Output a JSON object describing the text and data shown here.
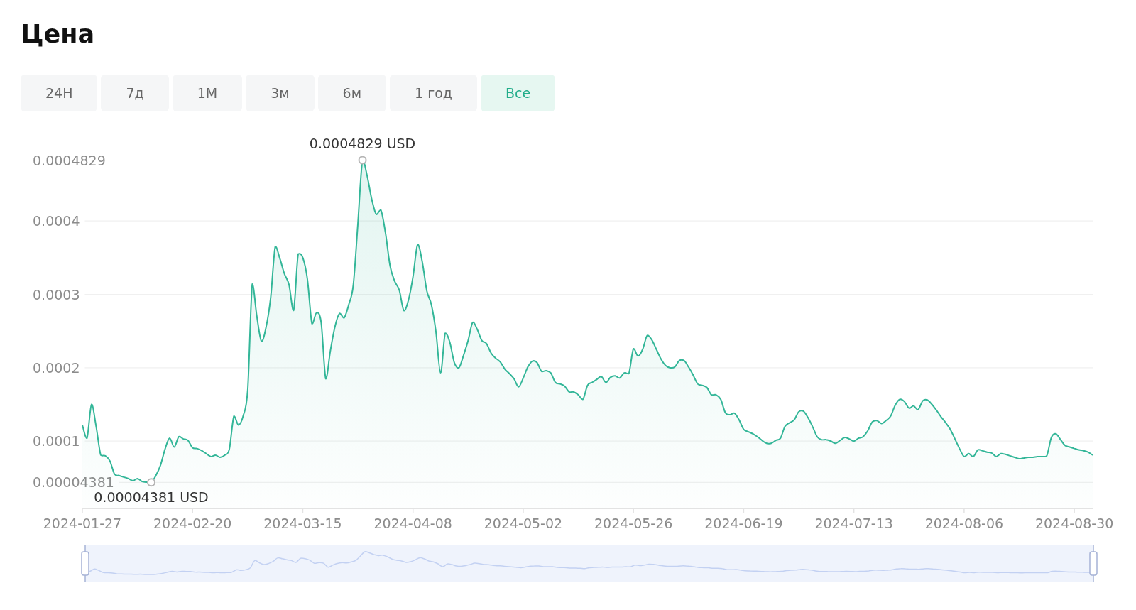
{
  "title": "Цена",
  "period_tabs": [
    {
      "label": "24H",
      "selected": false
    },
    {
      "label": "7д",
      "selected": false
    },
    {
      "label": "1M",
      "selected": false
    },
    {
      "label": "3м",
      "selected": false
    },
    {
      "label": "6м",
      "selected": false
    },
    {
      "label": "1 год",
      "selected": false
    },
    {
      "label": "Все",
      "selected": true
    }
  ],
  "price_chart": {
    "chart_data": {
      "type": "area",
      "grid": true,
      "categories": [
        "2024-01-27",
        null,
        null,
        null,
        null,
        null,
        null,
        null,
        null,
        null,
        null,
        null,
        null,
        null,
        null,
        null,
        null,
        null,
        null,
        null,
        null,
        null,
        null,
        null,
        "2024-02-20",
        null,
        null,
        null,
        null,
        null,
        null,
        null,
        null,
        null,
        null,
        null,
        null,
        null,
        null,
        null,
        null,
        null,
        null,
        null,
        null,
        null,
        null,
        null,
        "2024-03-15",
        null,
        null,
        null,
        null,
        null,
        null,
        null,
        null,
        null,
        null,
        null,
        null,
        null,
        null,
        null,
        null,
        null,
        null,
        null,
        null,
        null,
        null,
        null,
        "2024-04-08",
        null,
        null,
        null,
        null,
        null,
        null,
        null,
        null,
        null,
        null,
        null,
        null,
        null,
        null,
        null,
        null,
        null,
        null,
        null,
        null,
        null,
        null,
        null,
        "2024-05-02",
        null,
        null,
        null,
        null,
        null,
        null,
        null,
        null,
        null,
        null,
        null,
        null,
        null,
        null,
        null,
        null,
        null,
        null,
        null,
        null,
        null,
        null,
        null,
        "2024-05-26",
        null,
        null,
        null,
        null,
        null,
        null,
        null,
        null,
        null,
        null,
        null,
        null,
        null,
        null,
        null,
        null,
        null,
        null,
        null,
        null,
        null,
        null,
        null,
        "2024-06-19",
        null,
        null,
        null,
        null,
        null,
        null,
        null,
        null,
        null,
        null,
        null,
        null,
        null,
        null,
        null,
        null,
        null,
        null,
        null,
        null,
        null,
        null,
        null,
        "2024-07-13",
        null,
        null,
        null,
        null,
        null,
        null,
        null,
        null,
        null,
        null,
        null,
        null,
        null,
        null,
        null,
        null,
        null,
        null,
        null,
        null,
        null,
        null,
        null,
        "2024-08-06",
        null,
        null,
        null,
        null,
        null,
        null,
        null,
        null,
        null,
        null,
        null,
        null,
        null,
        null,
        null,
        null,
        null,
        null,
        null,
        null,
        null,
        null,
        null,
        "2024-08-30",
        null,
        null,
        null,
        null
      ],
      "values": [
        0.000122,
        0.000104,
        0.00015,
        0.00012,
        8.1e-05,
        8e-05,
        7.3e-05,
        5.5e-05,
        5.3e-05,
        5.1e-05,
        4.9e-05,
        4.6e-05,
        4.9e-05,
        4.5e-05,
        4.4e-05,
        4.381e-05,
        5.3e-05,
        6.7e-05,
        8.9e-05,
        0.000104,
        9.2e-05,
        0.000106,
        0.000103,
        0.000101,
        9.1e-05,
        9e-05,
        8.7e-05,
        8.3e-05,
        7.9e-05,
        8.1e-05,
        7.8e-05,
        8.1e-05,
        8.9e-05,
        0.000134,
        0.000122,
        0.000134,
        0.00017,
        0.000314,
        0.00027,
        0.000236,
        0.000255,
        0.000295,
        0.000365,
        0.000349,
        0.000328,
        0.000313,
        0.000278,
        0.000355,
        0.00035,
        0.000321,
        0.00026,
        0.000275,
        0.000262,
        0.000185,
        0.000223,
        0.000256,
        0.000274,
        0.000268,
        0.000286,
        0.000313,
        0.000397,
        0.0004829,
        0.000462,
        0.00043,
        0.000409,
        0.000415,
        0.000384,
        0.000339,
        0.000318,
        0.000306,
        0.000278,
        0.000292,
        0.000324,
        0.000368,
        0.000345,
        0.000305,
        0.000286,
        0.000249,
        0.000193,
        0.000247,
        0.000235,
        0.000207,
        0.0002,
        0.000217,
        0.000237,
        0.000262,
        0.000252,
        0.000237,
        0.000233,
        0.00022,
        0.000213,
        0.000208,
        0.000198,
        0.000192,
        0.000185,
        0.000174,
        0.000186,
        0.000201,
        0.000209,
        0.000207,
        0.000195,
        0.000196,
        0.000193,
        0.00018,
        0.000178,
        0.000175,
        0.000167,
        0.000167,
        0.000163,
        0.000157,
        0.000176,
        0.00018,
        0.000184,
        0.000188,
        0.00018,
        0.000187,
        0.000189,
        0.000186,
        0.000193,
        0.000192,
        0.000226,
        0.000216,
        0.000225,
        0.000244,
        0.000238,
        0.000225,
        0.000212,
        0.000203,
        0.0002,
        0.000201,
        0.00021,
        0.00021,
        0.000201,
        0.00019,
        0.000178,
        0.000176,
        0.000173,
        0.000163,
        0.000163,
        0.000157,
        0.000139,
        0.000136,
        0.000138,
        0.000129,
        0.000116,
        0.000113,
        0.00011,
        0.000106,
        0.000101,
        9.7e-05,
        9.7e-05,
        0.000101,
        0.000104,
        0.00012,
        0.000125,
        0.000129,
        0.00014,
        0.000141,
        0.000132,
        0.00012,
        0.000106,
        0.000102,
        0.000102,
        0.0001,
        9.7e-05,
        0.000101,
        0.000105,
        0.000103,
        0.0001,
        0.000104,
        0.000106,
        0.000114,
        0.000126,
        0.000128,
        0.000124,
        0.000128,
        0.000134,
        0.000149,
        0.000157,
        0.000154,
        0.000145,
        0.000148,
        0.000143,
        0.000155,
        0.000156,
        0.00015,
        0.000142,
        0.000133,
        0.000125,
        0.000116,
        0.000103,
        9e-05,
        7.9e-05,
        8.3e-05,
        7.9e-05,
        8.8e-05,
        8.7e-05,
        8.5e-05,
        8.4e-05,
        7.9e-05,
        8.3e-05,
        8.2e-05,
        8e-05,
        7.8e-05,
        7.6e-05,
        7.7e-05,
        7.8e-05,
        7.8e-05,
        7.9e-05,
        7.9e-05,
        8e-05,
        0.000105,
        0.00011,
        0.000102,
        9.4e-05,
        9.2e-05,
        9e-05,
        8.8e-05,
        8.7e-05,
        8.5e-05,
        8.1e-05
      ],
      "ylim": [
        8e-06,
        0.0004829
      ],
      "yticks": [
        {
          "value": 4.381e-05,
          "label": "0.00004381"
        },
        {
          "value": 0.0001,
          "label": "0.0001"
        },
        {
          "value": 0.0002,
          "label": "0.0002"
        },
        {
          "value": 0.0003,
          "label": "0.0003"
        },
        {
          "value": 0.0004,
          "label": "0.0004"
        },
        {
          "value": 0.0004829,
          "label": "0.0004829"
        }
      ],
      "annotations": [
        {
          "y": 0.0004829,
          "text": "0.0004829 USD"
        },
        {
          "y": 4.381e-05,
          "text": "0.00004381 USD"
        }
      ]
    },
    "range_slider": {
      "level": 1
    }
  }
}
